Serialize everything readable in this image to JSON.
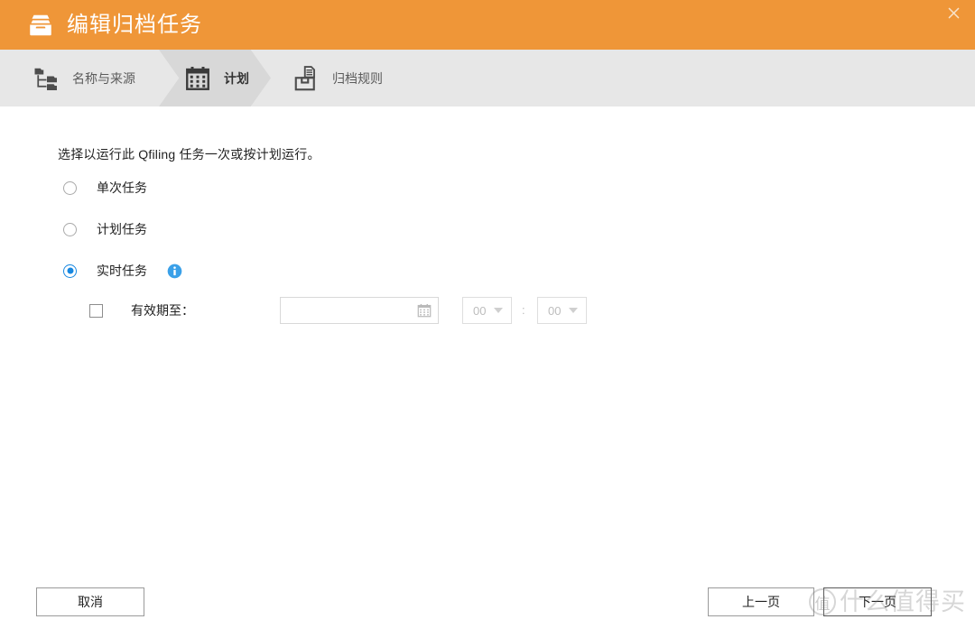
{
  "window": {
    "title": "编辑归档任务",
    "title_icon": "archive-box-icon",
    "close_icon": "close-icon",
    "accent_color": "#ef9638",
    "stepbar_color": "#e7e7e7",
    "active_step_color": "#d8d8d8"
  },
  "steps": [
    {
      "id": "name-and-source",
      "label": "名称与来源",
      "icon": "folder-tree-icon",
      "active": false
    },
    {
      "id": "schedule",
      "label": "计划",
      "icon": "calendar-icon",
      "active": true
    },
    {
      "id": "archive-rules",
      "label": "归档规则",
      "icon": "archive-rule-icon",
      "active": false
    }
  ],
  "main": {
    "intro": "选择以运行此 Qfiling 任务一次或按计划运行。",
    "options": [
      {
        "id": "one-time",
        "label": "单次任务",
        "selected": false,
        "has_info": false
      },
      {
        "id": "scheduled",
        "label": "计划任务",
        "selected": false,
        "has_info": false
      },
      {
        "id": "real-time",
        "label": "实时任务",
        "selected": true,
        "has_info": true,
        "info_icon": "info-icon",
        "info_color": "#3aa0e8"
      }
    ],
    "expiry": {
      "checkbox_checked": false,
      "label": "有效期至：",
      "date_value": "",
      "date_placeholder": "",
      "calendar_icon": "calendar-icon",
      "hour": "00",
      "minute": "00",
      "time_separator": ":",
      "caret_icon": "chevron-down-icon",
      "enabled": false
    }
  },
  "footer": {
    "cancel_label": "取消",
    "prev_label": "上一页",
    "next_label": "下一页"
  },
  "watermark": {
    "badge": "值",
    "text": "什么值得买"
  }
}
